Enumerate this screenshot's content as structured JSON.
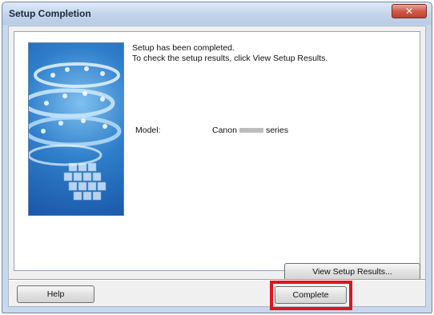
{
  "window": {
    "title": "Setup Completion",
    "close_label": "✕"
  },
  "message": {
    "line1": "Setup has been completed.",
    "line2": "To check the setup results, click View Setup Results."
  },
  "model": {
    "label": "Model:",
    "brand": "Canon",
    "suffix": "series"
  },
  "buttons": {
    "view_results": "View Setup Results...",
    "help": "Help",
    "complete": "Complete"
  },
  "colors": {
    "highlight": "#e0141b",
    "close_button": "#c8493a"
  }
}
